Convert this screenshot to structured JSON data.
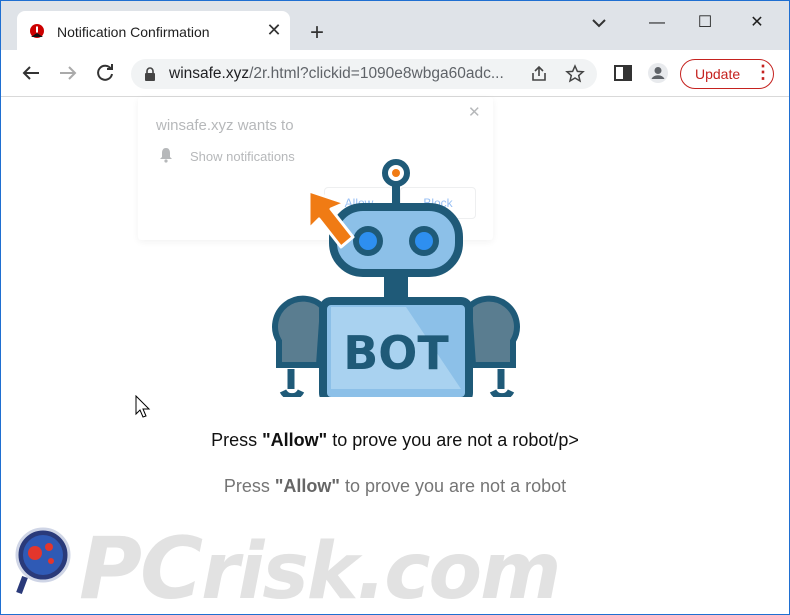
{
  "browser": {
    "tab": {
      "title": "Notification Confirmation",
      "close": "✕"
    },
    "newtab": "+",
    "window_controls": {
      "minimize": "—",
      "maximize": "☐",
      "close": "✕"
    },
    "address": {
      "host": "winsafe.xyz",
      "path": "/2r.html?clickid=1090e8wbga60adc..."
    },
    "update_button": {
      "label": "Update",
      "menu": "⋮"
    }
  },
  "permission_prompt": {
    "title": "winsafe.xyz wants to",
    "close": "✕",
    "item": "Show notifications",
    "allow": "Allow",
    "block": "Block"
  },
  "robot": {
    "badge": "BOT"
  },
  "messages": {
    "line1_pre": "Press ",
    "line1_strong": "\"Allow\"",
    "line1_post": " to prove you are not a robot/p>",
    "line2_pre": "Press ",
    "line2_strong": "\"Allow\"",
    "line2_post": " to prove you are not a robot"
  },
  "watermark": {
    "pc": "PC",
    "rest": "risk.com"
  },
  "colors": {
    "accent": "#c5221f",
    "arrow": "#f07b14",
    "robot_dark": "#1f5a78",
    "robot_light": "#8cc0e8",
    "eye": "#2e8ff0"
  }
}
